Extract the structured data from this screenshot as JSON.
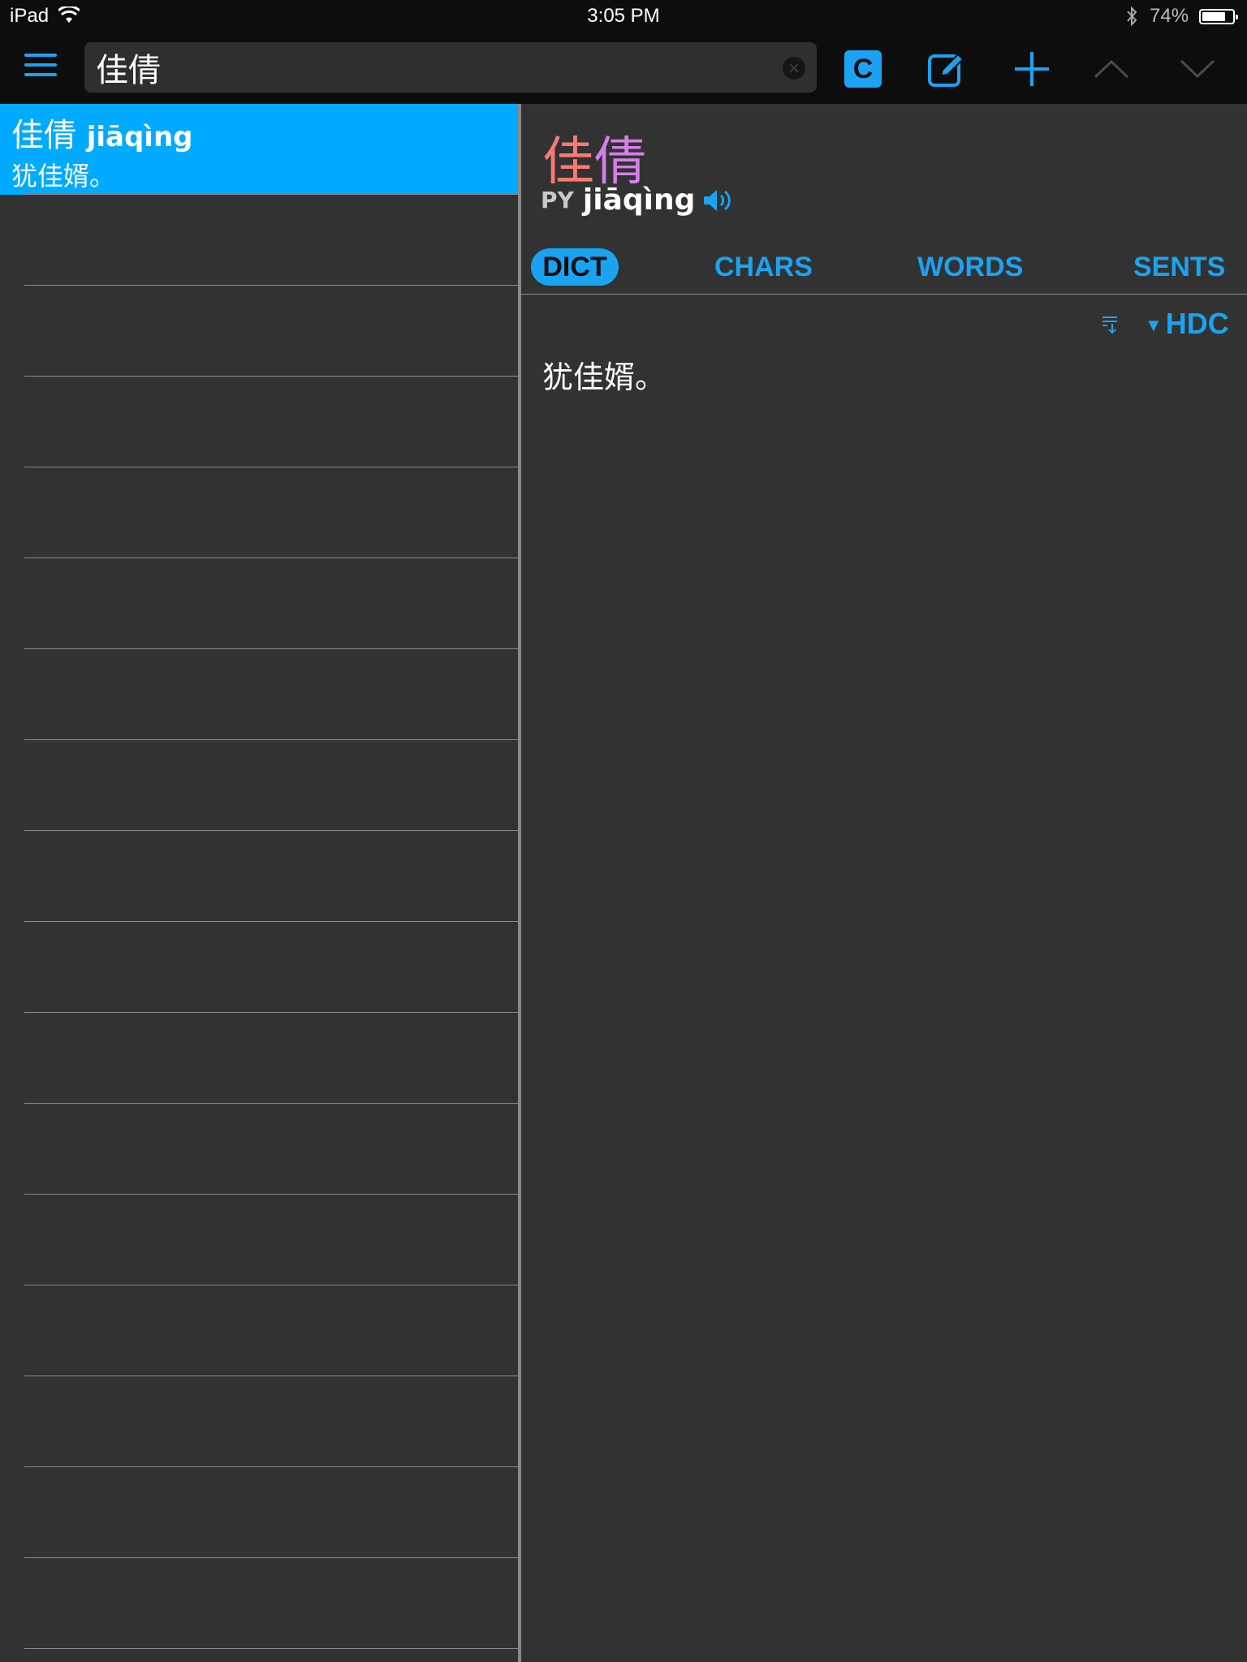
{
  "status_bar": {
    "device": "iPad",
    "time": "3:05 PM",
    "battery_percent": "74%",
    "battery_level": 0.74
  },
  "toolbar": {
    "search_value": "佳倩",
    "c_button_label": "C",
    "icons": [
      "menu-icon",
      "clear-icon",
      "edit-icon",
      "plus-icon",
      "chevron-up-icon",
      "chevron-down-icon"
    ]
  },
  "results": {
    "items": [
      {
        "headword": "佳倩",
        "pinyin": "jiāqìng",
        "definition": "犹佳婿。"
      }
    ],
    "empty_row_count": 16
  },
  "detail": {
    "headword_chars": [
      "佳",
      "倩"
    ],
    "pinyin_label": "PY",
    "pinyin": "jiāqìng",
    "tabs": [
      {
        "label": "DICT",
        "active": true
      },
      {
        "label": "CHARS",
        "active": false
      },
      {
        "label": "WORDS",
        "active": false
      },
      {
        "label": "SENTS",
        "active": false
      }
    ],
    "source_label": "HDC",
    "source_arrow": "▼",
    "definition": "犹佳婿。"
  },
  "colors": {
    "accent": "#1aa3f0",
    "selection": "#00aaff",
    "background": "#323232",
    "toolbar": "#0d0d0d",
    "tone1": "#f47a73",
    "tone4": "#d67ee8"
  }
}
